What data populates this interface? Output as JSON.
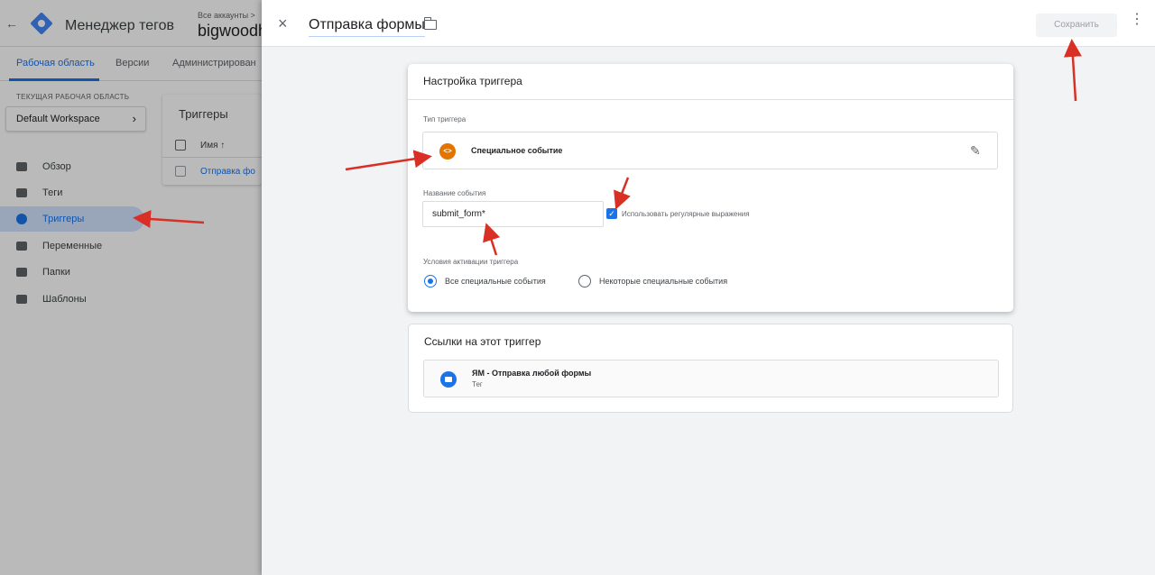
{
  "app": {
    "back_icon": "arrow-left-icon",
    "logo_icon": "gtm-logo-icon",
    "title": "Менеджер тегов",
    "account_breadcrumb": "Все аккаунты >",
    "account_name": "bigwoodh"
  },
  "tabs": [
    {
      "label": "Рабочая область",
      "active": true
    },
    {
      "label": "Версии",
      "active": false
    },
    {
      "label": "Администрирован",
      "active": false
    }
  ],
  "sidebar": {
    "workspace_label": "ТЕКУЩАЯ РАБОЧАЯ ОБЛАСТЬ",
    "workspace_name": "Default Workspace",
    "workspace_chevron": "›",
    "items": [
      {
        "label": "Обзор",
        "icon": "overview-icon",
        "active": false
      },
      {
        "label": "Теги",
        "icon": "tag-icon",
        "active": false
      },
      {
        "label": "Триггеры",
        "icon": "trigger-icon",
        "active": true
      },
      {
        "label": "Переменные",
        "icon": "variable-icon",
        "active": false
      },
      {
        "label": "Папки",
        "icon": "folder-icon",
        "active": false
      },
      {
        "label": "Шаблоны",
        "icon": "template-icon",
        "active": false
      }
    ]
  },
  "triggers_list": {
    "title": "Триггеры",
    "column_name": "Имя ↑",
    "rows": [
      "Отправка фо"
    ]
  },
  "panel": {
    "close_icon": "×",
    "title": "Отправка формы",
    "folder_icon": "folder-icon",
    "save_label": "Сохранить",
    "more_icon": "⋮",
    "config_card": {
      "title": "Настройка триггера",
      "type_label": "Тип триггера",
      "type_icon": "<>",
      "type_value": "Специальное событие",
      "edit_icon": "✎",
      "event_name_label": "Название события",
      "event_name_value": "submit_form*",
      "regex_checked": true,
      "regex_check_glyph": "✓",
      "regex_label": "Использовать регулярные выражения",
      "conditions_label": "Условия активации триггера",
      "options": [
        {
          "label": "Все специальные события",
          "selected": true
        },
        {
          "label": "Некоторые специальные события",
          "selected": false
        }
      ]
    },
    "refs_card": {
      "title": "Ссылки на этот триггер",
      "item_title": "ЯМ - Отправка любой формы",
      "item_subtitle": "Тег"
    }
  },
  "colors": {
    "accent": "#1a73e8",
    "trigger_type": "#e37400",
    "annotation": "#d93025"
  }
}
